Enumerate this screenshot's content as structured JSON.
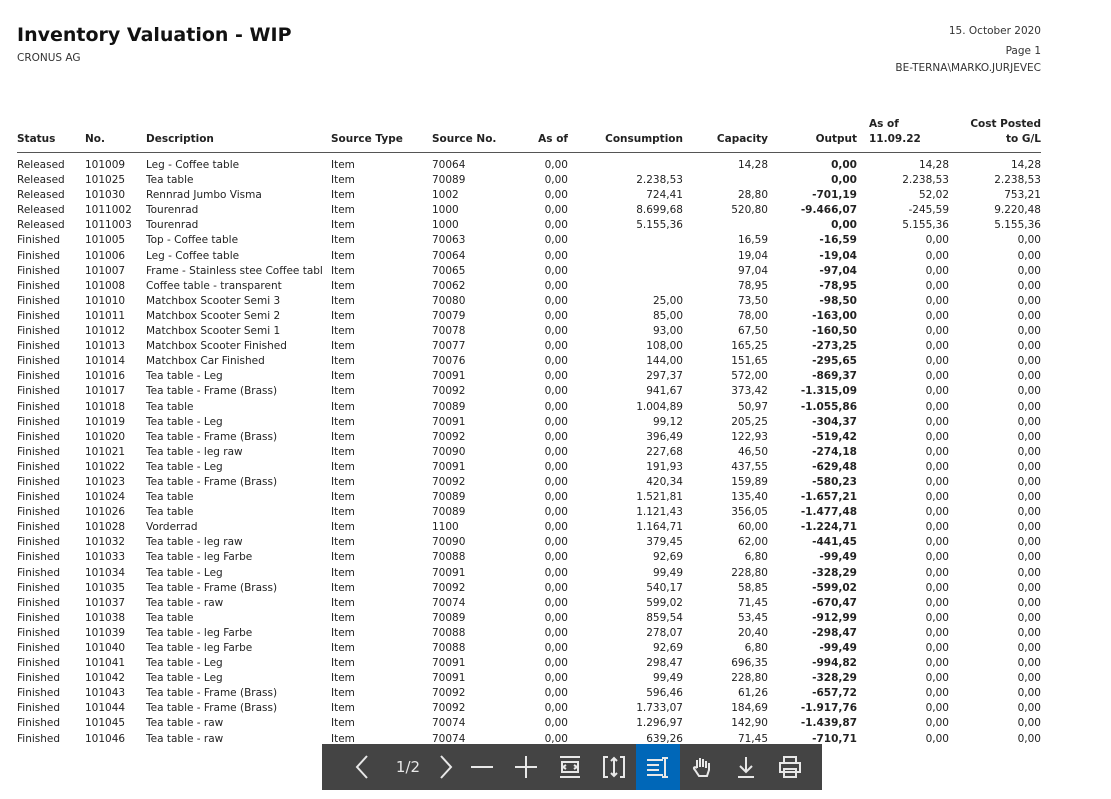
{
  "report": {
    "title": "Inventory Valuation - WIP",
    "company": "CRONUS AG",
    "date": "15. October 2020",
    "page": "Page 1",
    "user": "BE-TERNA\\MARKO.JURJEVEC"
  },
  "columns": [
    "Status",
    "No.",
    "Description",
    "Source Type",
    "Source No.",
    "As of",
    "Consumption",
    "Capacity",
    "Output",
    "As of 11.09.22",
    "Cost Posted to G/L"
  ],
  "rows": [
    [
      "Released",
      "101009",
      "Leg - Coffee table",
      "Item",
      "70064",
      "0,00",
      "",
      "14,28",
      "0,00",
      "14,28",
      "14,28"
    ],
    [
      "Released",
      "101025",
      "Tea table",
      "Item",
      "70089",
      "0,00",
      "2.238,53",
      "",
      "0,00",
      "2.238,53",
      "2.238,53"
    ],
    [
      "Released",
      "101030",
      "Rennrad Jumbo Visma",
      "Item",
      "1002",
      "0,00",
      "724,41",
      "28,80",
      "-701,19",
      "52,02",
      "753,21"
    ],
    [
      "Released",
      "1011002",
      "Tourenrad",
      "Item",
      "1000",
      "0,00",
      "8.699,68",
      "520,80",
      "-9.466,07",
      "-245,59",
      "9.220,48"
    ],
    [
      "Released",
      "1011003",
      "Tourenrad",
      "Item",
      "1000",
      "0,00",
      "5.155,36",
      "",
      "0,00",
      "5.155,36",
      "5.155,36"
    ],
    [
      "Finished",
      "101005",
      "Top - Coffee table",
      "Item",
      "70063",
      "0,00",
      "",
      "16,59",
      "-16,59",
      "0,00",
      "0,00"
    ],
    [
      "Finished",
      "101006",
      "Leg - Coffee table",
      "Item",
      "70064",
      "0,00",
      "",
      "19,04",
      "-19,04",
      "0,00",
      "0,00"
    ],
    [
      "Finished",
      "101007",
      "Frame - Stainless stee Coffee tabl",
      "Item",
      "70065",
      "0,00",
      "",
      "97,04",
      "-97,04",
      "0,00",
      "0,00"
    ],
    [
      "Finished",
      "101008",
      "Coffee table - transparent",
      "Item",
      "70062",
      "0,00",
      "",
      "78,95",
      "-78,95",
      "0,00",
      "0,00"
    ],
    [
      "Finished",
      "101010",
      "Matchbox Scooter Semi 3",
      "Item",
      "70080",
      "0,00",
      "25,00",
      "73,50",
      "-98,50",
      "0,00",
      "0,00"
    ],
    [
      "Finished",
      "101011",
      "Matchbox Scooter Semi 2",
      "Item",
      "70079",
      "0,00",
      "85,00",
      "78,00",
      "-163,00",
      "0,00",
      "0,00"
    ],
    [
      "Finished",
      "101012",
      "Matchbox Scooter Semi 1",
      "Item",
      "70078",
      "0,00",
      "93,00",
      "67,50",
      "-160,50",
      "0,00",
      "0,00"
    ],
    [
      "Finished",
      "101013",
      "Matchbox Scooter Finished",
      "Item",
      "70077",
      "0,00",
      "108,00",
      "165,25",
      "-273,25",
      "0,00",
      "0,00"
    ],
    [
      "Finished",
      "101014",
      "Matchbox Car Finished",
      "Item",
      "70076",
      "0,00",
      "144,00",
      "151,65",
      "-295,65",
      "0,00",
      "0,00"
    ],
    [
      "Finished",
      "101016",
      "Tea table - Leg",
      "Item",
      "70091",
      "0,00",
      "297,37",
      "572,00",
      "-869,37",
      "0,00",
      "0,00"
    ],
    [
      "Finished",
      "101017",
      "Tea table - Frame (Brass)",
      "Item",
      "70092",
      "0,00",
      "941,67",
      "373,42",
      "-1.315,09",
      "0,00",
      "0,00"
    ],
    [
      "Finished",
      "101018",
      "Tea table",
      "Item",
      "70089",
      "0,00",
      "1.004,89",
      "50,97",
      "-1.055,86",
      "0,00",
      "0,00"
    ],
    [
      "Finished",
      "101019",
      "Tea table - Leg",
      "Item",
      "70091",
      "0,00",
      "99,12",
      "205,25",
      "-304,37",
      "0,00",
      "0,00"
    ],
    [
      "Finished",
      "101020",
      "Tea table - Frame (Brass)",
      "Item",
      "70092",
      "0,00",
      "396,49",
      "122,93",
      "-519,42",
      "0,00",
      "0,00"
    ],
    [
      "Finished",
      "101021",
      "Tea table - leg raw",
      "Item",
      "70090",
      "0,00",
      "227,68",
      "46,50",
      "-274,18",
      "0,00",
      "0,00"
    ],
    [
      "Finished",
      "101022",
      "Tea table - Leg",
      "Item",
      "70091",
      "0,00",
      "191,93",
      "437,55",
      "-629,48",
      "0,00",
      "0,00"
    ],
    [
      "Finished",
      "101023",
      "Tea table - Frame (Brass)",
      "Item",
      "70092",
      "0,00",
      "420,34",
      "159,89",
      "-580,23",
      "0,00",
      "0,00"
    ],
    [
      "Finished",
      "101024",
      "Tea table",
      "Item",
      "70089",
      "0,00",
      "1.521,81",
      "135,40",
      "-1.657,21",
      "0,00",
      "0,00"
    ],
    [
      "Finished",
      "101026",
      "Tea table",
      "Item",
      "70089",
      "0,00",
      "1.121,43",
      "356,05",
      "-1.477,48",
      "0,00",
      "0,00"
    ],
    [
      "Finished",
      "101028",
      "Vorderrad",
      "Item",
      "1100",
      "0,00",
      "1.164,71",
      "60,00",
      "-1.224,71",
      "0,00",
      "0,00"
    ],
    [
      "Finished",
      "101032",
      "Tea table - leg raw",
      "Item",
      "70090",
      "0,00",
      "379,45",
      "62,00",
      "-441,45",
      "0,00",
      "0,00"
    ],
    [
      "Finished",
      "101033",
      "Tea table - leg Farbe",
      "Item",
      "70088",
      "0,00",
      "92,69",
      "6,80",
      "-99,49",
      "0,00",
      "0,00"
    ],
    [
      "Finished",
      "101034",
      "Tea table - Leg",
      "Item",
      "70091",
      "0,00",
      "99,49",
      "228,80",
      "-328,29",
      "0,00",
      "0,00"
    ],
    [
      "Finished",
      "101035",
      "Tea table - Frame (Brass)",
      "Item",
      "70092",
      "0,00",
      "540,17",
      "58,85",
      "-599,02",
      "0,00",
      "0,00"
    ],
    [
      "Finished",
      "101037",
      "Tea table - raw",
      "Item",
      "70074",
      "0,00",
      "599,02",
      "71,45",
      "-670,47",
      "0,00",
      "0,00"
    ],
    [
      "Finished",
      "101038",
      "Tea table",
      "Item",
      "70089",
      "0,00",
      "859,54",
      "53,45",
      "-912,99",
      "0,00",
      "0,00"
    ],
    [
      "Finished",
      "101039",
      "Tea table - leg Farbe",
      "Item",
      "70088",
      "0,00",
      "278,07",
      "20,40",
      "-298,47",
      "0,00",
      "0,00"
    ],
    [
      "Finished",
      "101040",
      "Tea table - leg Farbe",
      "Item",
      "70088",
      "0,00",
      "92,69",
      "6,80",
      "-99,49",
      "0,00",
      "0,00"
    ],
    [
      "Finished",
      "101041",
      "Tea table - Leg",
      "Item",
      "70091",
      "0,00",
      "298,47",
      "696,35",
      "-994,82",
      "0,00",
      "0,00"
    ],
    [
      "Finished",
      "101042",
      "Tea table - Leg",
      "Item",
      "70091",
      "0,00",
      "99,49",
      "228,80",
      "-328,29",
      "0,00",
      "0,00"
    ],
    [
      "Finished",
      "101043",
      "Tea table - Frame (Brass)",
      "Item",
      "70092",
      "0,00",
      "596,46",
      "61,26",
      "-657,72",
      "0,00",
      "0,00"
    ],
    [
      "Finished",
      "101044",
      "Tea table - Frame (Brass)",
      "Item",
      "70092",
      "0,00",
      "1.733,07",
      "184,69",
      "-1.917,76",
      "0,00",
      "0,00"
    ],
    [
      "Finished",
      "101045",
      "Tea table - raw",
      "Item",
      "70074",
      "0,00",
      "1.296,97",
      "142,90",
      "-1.439,87",
      "0,00",
      "0,00"
    ],
    [
      "Finished",
      "101046",
      "Tea table - raw",
      "Item",
      "70074",
      "0,00",
      "639,26",
      "71,45",
      "-710,71",
      "0,00",
      "0,00"
    ]
  ],
  "toolbar": {
    "page_indicator": "1/2",
    "buttons": [
      "previous-page-icon",
      "next-page-icon",
      "zoom-out-icon",
      "zoom-in-icon",
      "fit-width-icon",
      "fit-height-icon",
      "text-select-icon",
      "hand-tool-icon",
      "download-icon",
      "print-icon"
    ]
  }
}
